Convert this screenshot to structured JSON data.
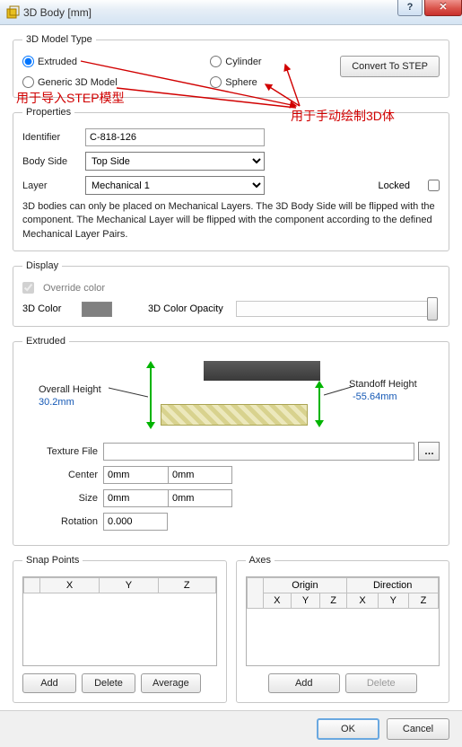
{
  "window": {
    "title": "3D Body [mm]"
  },
  "modelType": {
    "legend": "3D Model Type",
    "options": {
      "extruded": "Extruded",
      "generic": "Generic 3D Model",
      "cylinder": "Cylinder",
      "sphere": "Sphere"
    },
    "convertBtn": "Convert To STEP"
  },
  "annotations": {
    "importStep": "用于导入STEP模型",
    "manualDraw": "用于手动绘制3D体"
  },
  "properties": {
    "legend": "Properties",
    "identifierLabel": "Identifier",
    "identifierValue": "C-818-126",
    "bodySideLabel": "Body Side",
    "bodySideValue": "Top Side",
    "layerLabel": "Layer",
    "layerValue": "Mechanical 1",
    "lockedLabel": "Locked",
    "hint": "3D bodies can only be placed on Mechanical Layers. The 3D Body Side will be flipped with the component. The Mechanical Layer will be flipped with the component according to the defined Mechanical Layer Pairs."
  },
  "display": {
    "legend": "Display",
    "overrideColor": "Override color",
    "colorLabel": "3D Color",
    "opacityLabel": "3D Color Opacity"
  },
  "extruded": {
    "legend": "Extruded",
    "overallHeightLabel": "Overall Height",
    "overallHeightValue": "30.2mm",
    "standoffHeightLabel": "Standoff Height",
    "standoffHeightValue": "-55.64mm",
    "textureFileLabel": "Texture File",
    "textureFileValue": "",
    "centerLabel": "Center",
    "centerX": "0mm",
    "centerY": "0mm",
    "sizeLabel": "Size",
    "sizeX": "0mm",
    "sizeY": "0mm",
    "rotationLabel": "Rotation",
    "rotationValue": "0.000"
  },
  "snapPoints": {
    "legend": "Snap Points",
    "cols": {
      "x": "X",
      "y": "Y",
      "z": "Z"
    },
    "addBtn": "Add",
    "deleteBtn": "Delete",
    "averageBtn": "Average"
  },
  "axes": {
    "legend": "Axes",
    "originHdr": "Origin",
    "directionHdr": "Direction",
    "cols": {
      "x": "X",
      "y": "Y",
      "z": "Z"
    },
    "addBtn": "Add",
    "deleteBtn": "Delete"
  },
  "footer": {
    "ok": "OK",
    "cancel": "Cancel"
  }
}
